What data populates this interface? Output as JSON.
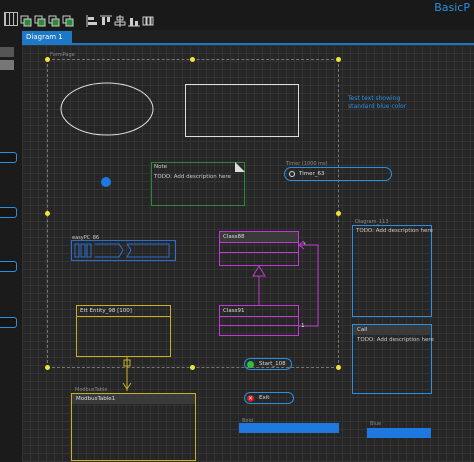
{
  "app": {
    "title": "BasicP"
  },
  "toolbar": {
    "icons": [
      "grid-icon",
      "copy-icon",
      "copy-icon",
      "copy-icon",
      "copy-icon",
      "align-left-icon",
      "align-top-icon",
      "align-center-icon",
      "align-bottom-icon",
      "distribute-icon"
    ]
  },
  "tabs": [
    {
      "label": "Diagram 1"
    }
  ],
  "colors": {
    "accent": "#1e78c8",
    "text_blue": "#2a8fe0",
    "note_green": "#2a8a3a",
    "class_magenta": "#c03ad0",
    "entity_yellow": "#c8b020",
    "handle_yellow": "#f2e23a"
  },
  "canvas": {
    "page_label": "FormPage",
    "blue_text": "Test text showing standard blue color",
    "note": {
      "title": "Note",
      "body": "TODO: Add description here"
    },
    "timer": {
      "caption": "Timer (1000 ms)",
      "label": "Timer_63"
    },
    "easypc": {
      "label": "easyPC_86"
    },
    "class88": {
      "title": "Class88"
    },
    "class91": {
      "title": "Class91"
    },
    "multiplicity_star": "*",
    "multiplicity_one": "1",
    "diagram113": {
      "caption": "Diagram_113",
      "body": "TODO: Add description here"
    },
    "call": {
      "title": "Call",
      "body": "TODO: Add description here"
    },
    "entity": {
      "title": "Ett Entity_98 [100]"
    },
    "modbus": {
      "caption": "ModbusTable",
      "title": "ModbusTable1"
    },
    "start": {
      "label": "Start_108"
    },
    "exit": {
      "label": "Exit"
    },
    "bar1_caption": "Bold",
    "bar2_caption": "Blue"
  }
}
